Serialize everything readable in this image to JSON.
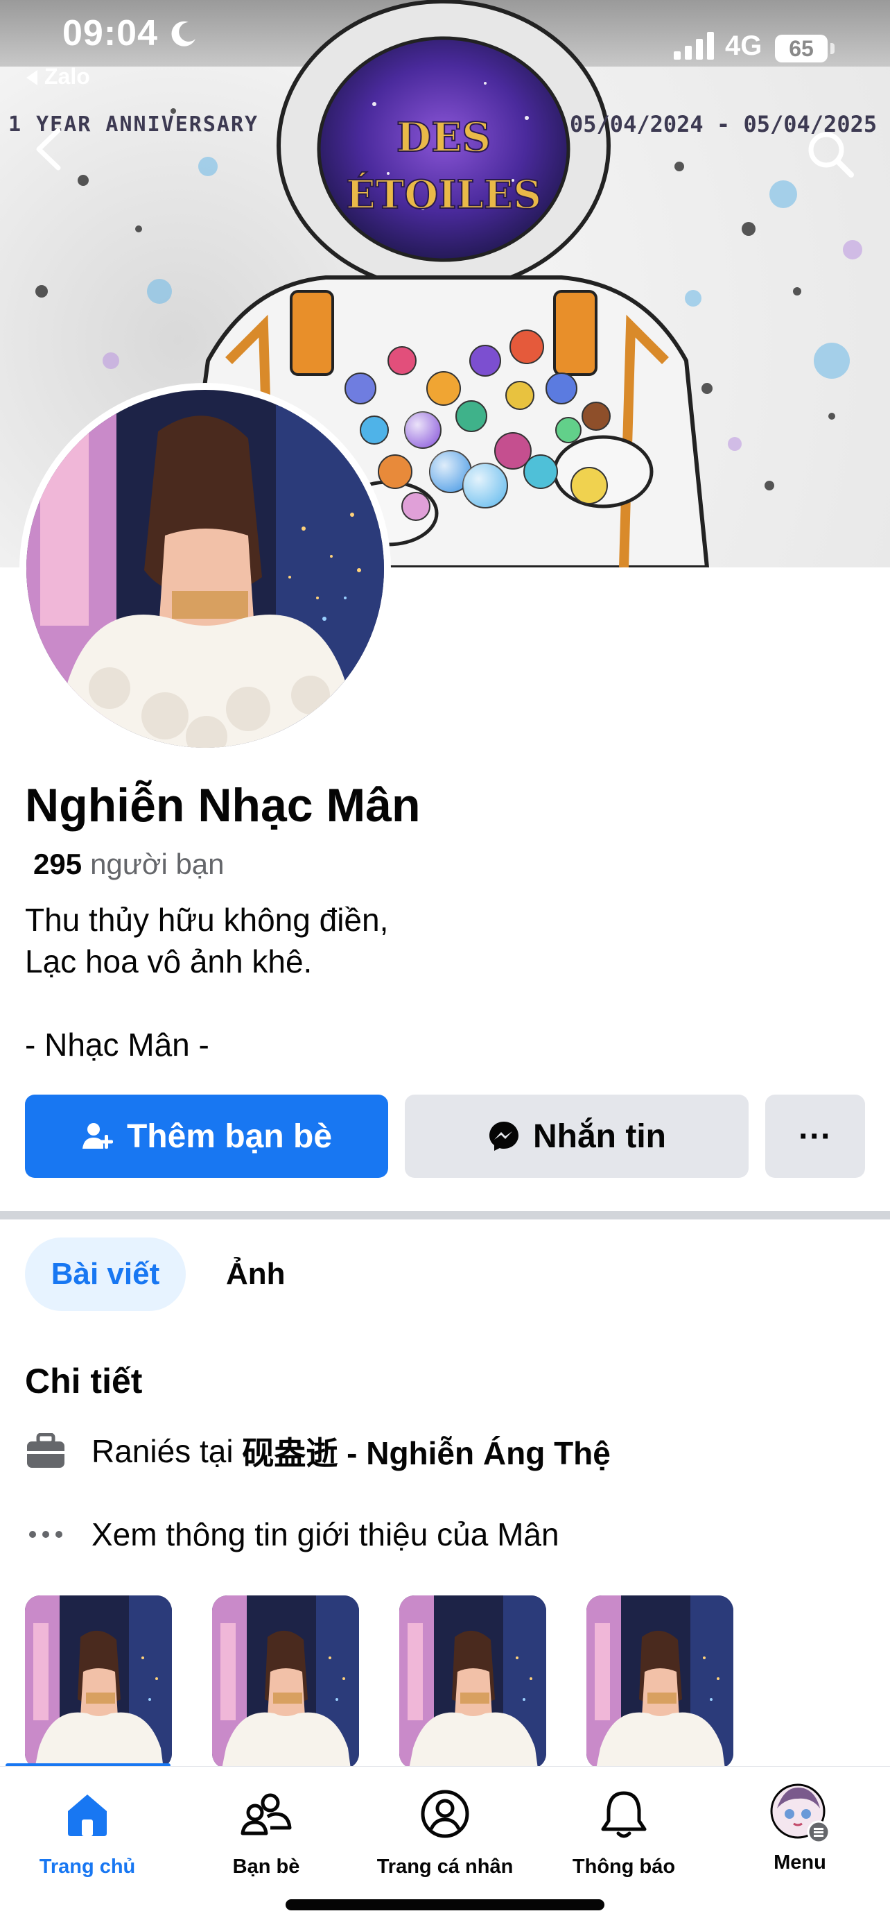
{
  "status_bar": {
    "time": "09:04",
    "network": "4G",
    "battery": "65"
  },
  "back_app": {
    "label": "Zalo"
  },
  "cover": {
    "left_caption": "1 YEAR ANNIVERSARY",
    "right_caption": "05/04/2024 - 05/04/2025",
    "helmet_text_line1": "DES",
    "helmet_text_line2": "ÉTOILES"
  },
  "profile": {
    "name": "Nghiễn Nhạc Mân",
    "friend_count": "295",
    "friend_label": "người bạn",
    "bio": [
      "Thu thủy hữu không điền,",
      "Lạc hoa vô ảnh khê.",
      "",
      "- Nhạc Mân -"
    ]
  },
  "actions": {
    "add_friend": "Thêm bạn bè",
    "message": "Nhắn tin",
    "more": "···"
  },
  "tabs": [
    {
      "label": "Bài viết",
      "active": true
    },
    {
      "label": "Ảnh",
      "active": false
    }
  ],
  "details": {
    "title": "Chi tiết",
    "work_prefix": "Raniés tại",
    "work_place": "砚盎逝 - Nghiễn Áng Thệ",
    "about": "Xem thông tin giới thiệu của Mân"
  },
  "bottom_nav": [
    {
      "label": "Trang chủ",
      "icon": "home-icon",
      "active": true
    },
    {
      "label": "Bạn bè",
      "icon": "friends-icon",
      "active": false
    },
    {
      "label": "Trang cá nhân",
      "icon": "profile-icon",
      "active": false
    },
    {
      "label": "Thông báo",
      "icon": "bell-icon",
      "active": false
    },
    {
      "label": "Menu",
      "icon": "avatar-menu-icon",
      "active": false
    }
  ],
  "colors": {
    "accent": "#1877f2",
    "button_gray": "#e4e6eb",
    "tab_bg": "#e7f3ff",
    "text_secondary": "#65676b"
  }
}
